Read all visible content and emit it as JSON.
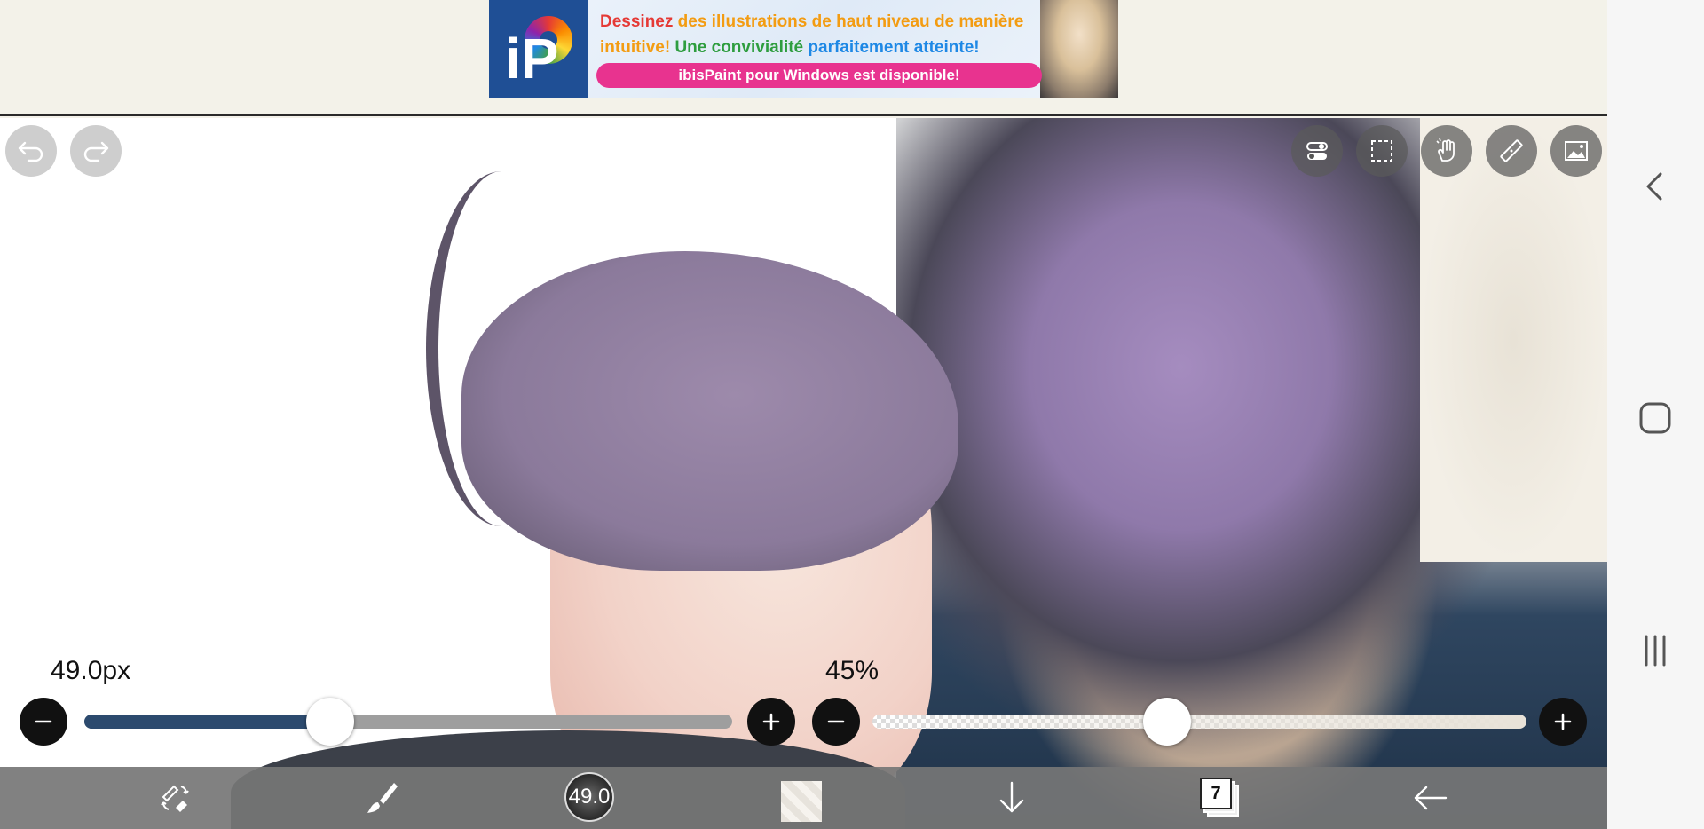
{
  "ad": {
    "logo_text": "iP",
    "line1": {
      "word1": "Dessinez",
      "rest": "des illustrations de haut niveau de manière"
    },
    "line2": {
      "word1": "intuitive!",
      "word2": "Une convivialité",
      "word3": "parfaitement atteinte!"
    },
    "cta": "ibisPaint pour Windows est disponible!",
    "colors": {
      "red": "#e53935",
      "orange": "#f39c12",
      "green": "#2e9d3f",
      "blue": "#1e88e5",
      "pink": "#e8338f"
    }
  },
  "canvas": {
    "top_left_buttons": [
      {
        "icon": "undo-icon"
      },
      {
        "icon": "redo-icon"
      }
    ],
    "top_right_tools": [
      {
        "icon": "toggle-icon"
      },
      {
        "icon": "selection-icon"
      },
      {
        "icon": "hand-icon"
      },
      {
        "icon": "ruler-icon"
      },
      {
        "icon": "image-icon"
      }
    ]
  },
  "brush_size": {
    "label": "49.0px",
    "value": 49.0,
    "fraction": 0.38,
    "track_color": "#2c4a6e"
  },
  "opacity": {
    "label": "45%",
    "value": 45,
    "fraction": 0.45
  },
  "toolbar": {
    "items": [
      {
        "icon": "tool-switch-icon"
      },
      {
        "icon": "brush-icon"
      },
      {
        "icon": "brush-size-indicator",
        "text": "49.0"
      },
      {
        "icon": "color-swatch"
      },
      {
        "icon": "down-arrow-icon"
      },
      {
        "icon": "layers-icon",
        "text": "7"
      },
      {
        "icon": "back-arrow-icon"
      }
    ],
    "brush_size_text": "49.0",
    "layers_count": "7"
  },
  "navbar": {
    "items": [
      {
        "icon": "back-chevron-icon"
      },
      {
        "icon": "home-icon"
      },
      {
        "icon": "recents-icon"
      }
    ]
  }
}
